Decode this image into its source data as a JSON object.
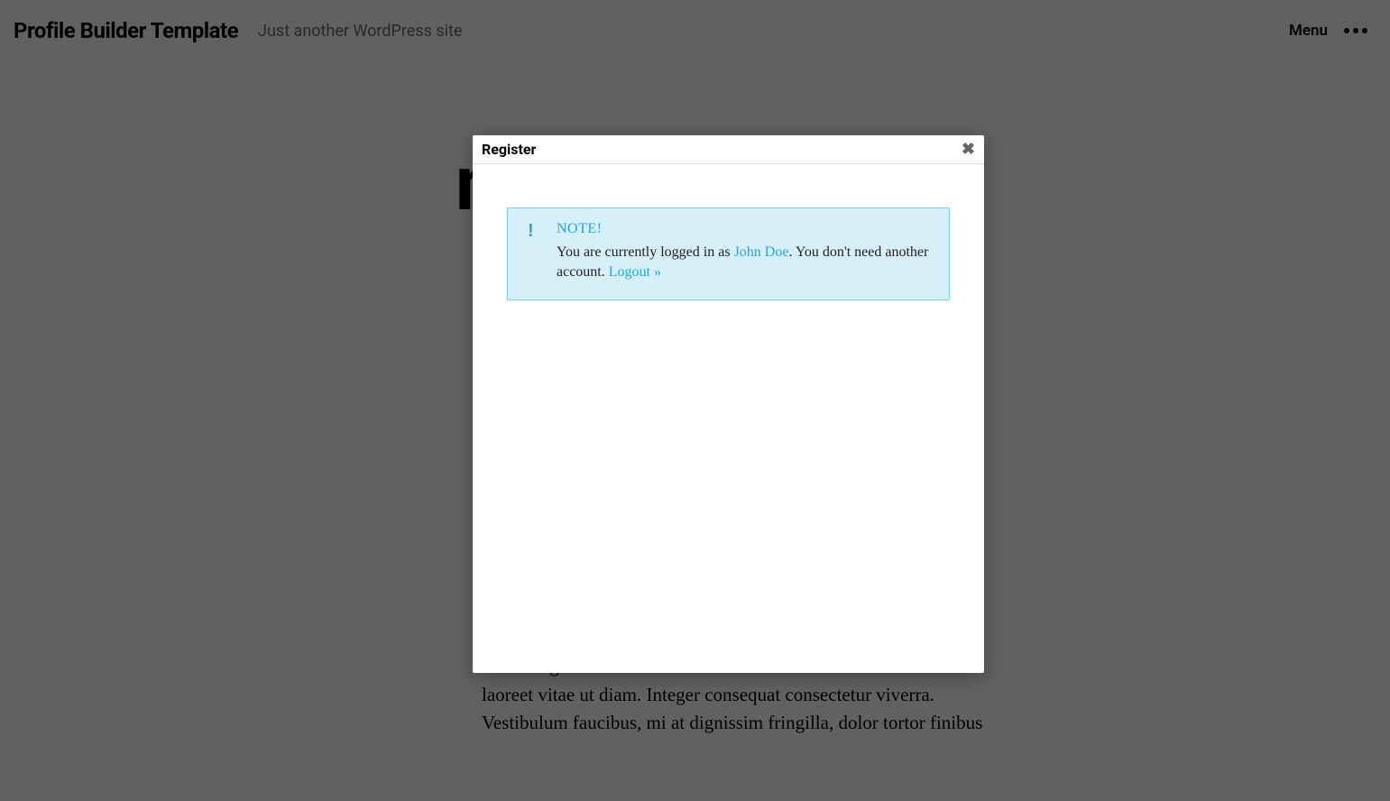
{
  "header": {
    "site_title": "Profile Builder Template",
    "tagline": "Just another WordPress site",
    "menu_label": "Menu"
  },
  "background": {
    "heading_fragment": "n",
    "paragraph": "ornare dignissim nulla et interdum. Cras at tellus ac odio iaculis laoreet vitae ut diam. Integer consequat consectetur viverra. Vestibulum faucibus, mi at dignissim fringilla, dolor tortor finibus"
  },
  "modal": {
    "title": "Register",
    "close_glyph": "✖",
    "note": {
      "icon": "!",
      "heading": "NOTE!",
      "text_before_user": "You are currently logged in as ",
      "user_name": "John Doe",
      "user_suffix": ". ",
      "text_after_user": "You don't need another account. ",
      "logout_label": "Logout »"
    }
  }
}
